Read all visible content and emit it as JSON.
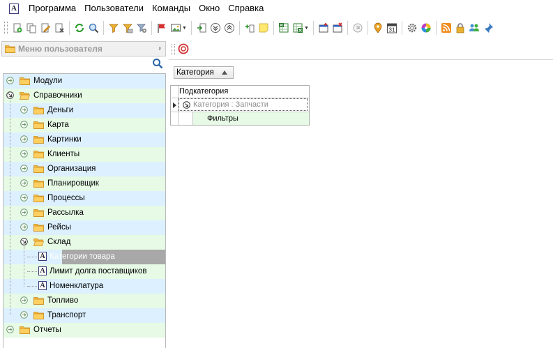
{
  "menubar": {
    "items": [
      "Программа",
      "Пользователи",
      "Команды",
      "Окно",
      "Справка"
    ]
  },
  "toolbar": {
    "icons": [
      "new-icon",
      "copy-icon",
      "edit-icon",
      "delete-icon",
      "refresh-icon",
      "search-icon",
      "filter-icon",
      "filter-clear-icon",
      "filter-settings-icon",
      "flag-icon",
      "image-icon",
      "move-icon",
      "expand-icon",
      "collapse-icon",
      "add-child-icon",
      "note-icon",
      "excel-export-icon",
      "excel-import-icon",
      "window-new-icon",
      "window-close-icon",
      "history-icon",
      "location-icon",
      "calendar-icon",
      "settings-icon",
      "color-icon",
      "rss-icon",
      "lock-icon",
      "users-icon",
      "pin-icon"
    ],
    "calendar_day": "31"
  },
  "left_panel": {
    "title": "Меню пользователя",
    "pin_glyph": "ᵖ"
  },
  "tree": {
    "items": [
      {
        "label": "Модули",
        "level": 0,
        "state": "collapsed",
        "type": "folder"
      },
      {
        "label": "Справочники",
        "level": 0,
        "state": "expanded",
        "type": "folder"
      },
      {
        "label": "Деньги",
        "level": 1,
        "state": "collapsed",
        "type": "folder"
      },
      {
        "label": "Карта",
        "level": 1,
        "state": "collapsed",
        "type": "folder"
      },
      {
        "label": "Картинки",
        "level": 1,
        "state": "collapsed",
        "type": "folder"
      },
      {
        "label": "Клиенты",
        "level": 1,
        "state": "collapsed",
        "type": "folder"
      },
      {
        "label": "Организация",
        "level": 1,
        "state": "collapsed",
        "type": "folder"
      },
      {
        "label": "Планировщик",
        "level": 1,
        "state": "collapsed",
        "type": "folder"
      },
      {
        "label": "Процессы",
        "level": 1,
        "state": "collapsed",
        "type": "folder"
      },
      {
        "label": "Рассылка",
        "level": 1,
        "state": "collapsed",
        "type": "folder"
      },
      {
        "label": "Рейсы",
        "level": 1,
        "state": "collapsed",
        "type": "folder"
      },
      {
        "label": "Склад",
        "level": 1,
        "state": "expanded",
        "type": "folder"
      },
      {
        "label": "Категории товара",
        "level": 2,
        "type": "doc",
        "selected": true
      },
      {
        "label": "Лимит долга поставщиков",
        "level": 2,
        "type": "doc"
      },
      {
        "label": "Номенклатура",
        "level": 2,
        "type": "doc"
      },
      {
        "label": "Топливо",
        "level": 1,
        "state": "collapsed",
        "type": "folder"
      },
      {
        "label": "Транспорт",
        "level": 1,
        "state": "collapsed",
        "type": "folder"
      },
      {
        "label": "Отчеты",
        "level": 0,
        "state": "collapsed",
        "type": "folder"
      }
    ],
    "doc_glyph": "A"
  },
  "grid": {
    "group_by": "Категория",
    "column_header": "Подкатегория",
    "group_row": "Категория : Запчасти",
    "rows": [
      "Фильтры"
    ]
  },
  "colors": {
    "row_blue": "#dcf0ff",
    "row_green": "#e6fae6",
    "selected": "#a8a8a8",
    "folder": "#f5b942"
  }
}
